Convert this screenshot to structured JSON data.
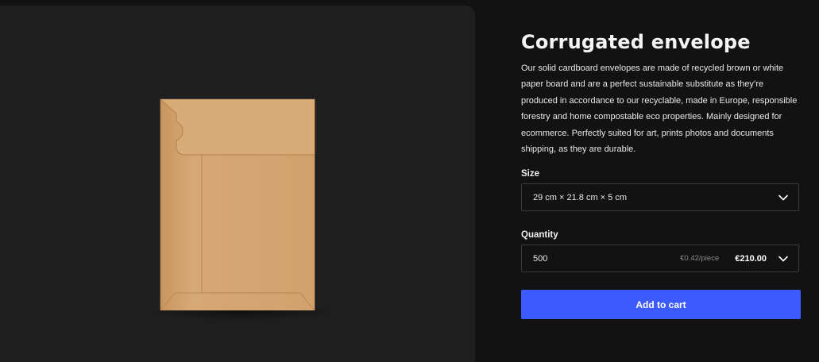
{
  "product": {
    "title": "Corrugated envelope",
    "description": "Our solid cardboard envelopes are made of recycled brown or white paper board and are a perfect sustainable substitute as they’re produced in accordance to our recyclable, made in Europe, responsible forestry and home compostable eco properties. Mainly designed for ecommerce. Perfectly suited for art, prints photos and documents shipping, as they are durable."
  },
  "size": {
    "label": "Size",
    "value": "29 cm × 21.8 cm × 5 cm"
  },
  "quantity": {
    "label": "Quantity",
    "value": "500",
    "unit_price": "€0.42/piece",
    "total": "€210.00"
  },
  "cart": {
    "button_label": "Add to cart"
  },
  "colors": {
    "background": "#121212",
    "image_panel": "#1e1e1e",
    "accent": "#3d5afe",
    "envelope": "#d4a574"
  },
  "icons": {
    "size_chevron": "chevron-down-icon",
    "quantity_chevron": "chevron-down-icon"
  }
}
